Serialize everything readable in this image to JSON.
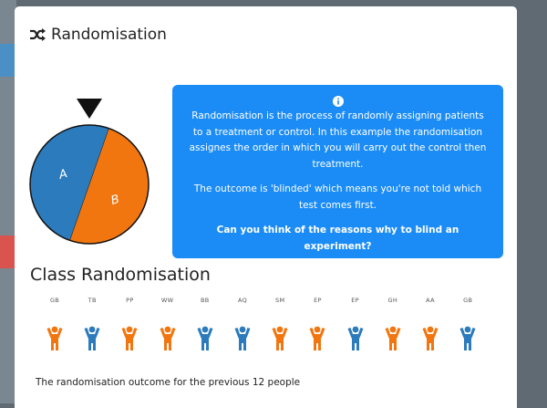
{
  "modal": {
    "title": "Randomisation",
    "title_icon": "shuffle-icon"
  },
  "wheel": {
    "labels": [
      "A",
      "B"
    ],
    "colors": {
      "A": "#2b7bbd",
      "B": "#f2760f"
    }
  },
  "info": {
    "icon": "info-circle-icon",
    "paragraph1": "Randomisation is the process of randomly assigning patients to a treatment or control. In this example the randomisation assignes the order in which you will carry out the control then treatment.",
    "paragraph2": "The outcome is 'blinded' which means you're not told which test comes first.",
    "question": "Can you think of the reasons why to blind an experiment?",
    "background": "#1b8cf6"
  },
  "class_section": {
    "title": "Class Randomisation",
    "people": [
      {
        "initials": "GB",
        "group": "orange"
      },
      {
        "initials": "TB",
        "group": "blue"
      },
      {
        "initials": "PP",
        "group": "orange"
      },
      {
        "initials": "WW",
        "group": "orange"
      },
      {
        "initials": "BB",
        "group": "blue"
      },
      {
        "initials": "AQ",
        "group": "blue"
      },
      {
        "initials": "SM",
        "group": "orange"
      },
      {
        "initials": "EP",
        "group": "orange"
      },
      {
        "initials": "EP",
        "group": "blue"
      },
      {
        "initials": "GH",
        "group": "orange"
      },
      {
        "initials": "AA",
        "group": "orange"
      },
      {
        "initials": "GB",
        "group": "blue"
      }
    ],
    "colors": {
      "orange": "#f2760f",
      "blue": "#2b7bbd"
    },
    "footer_text": "The randomisation outcome for the previous 12 people"
  }
}
